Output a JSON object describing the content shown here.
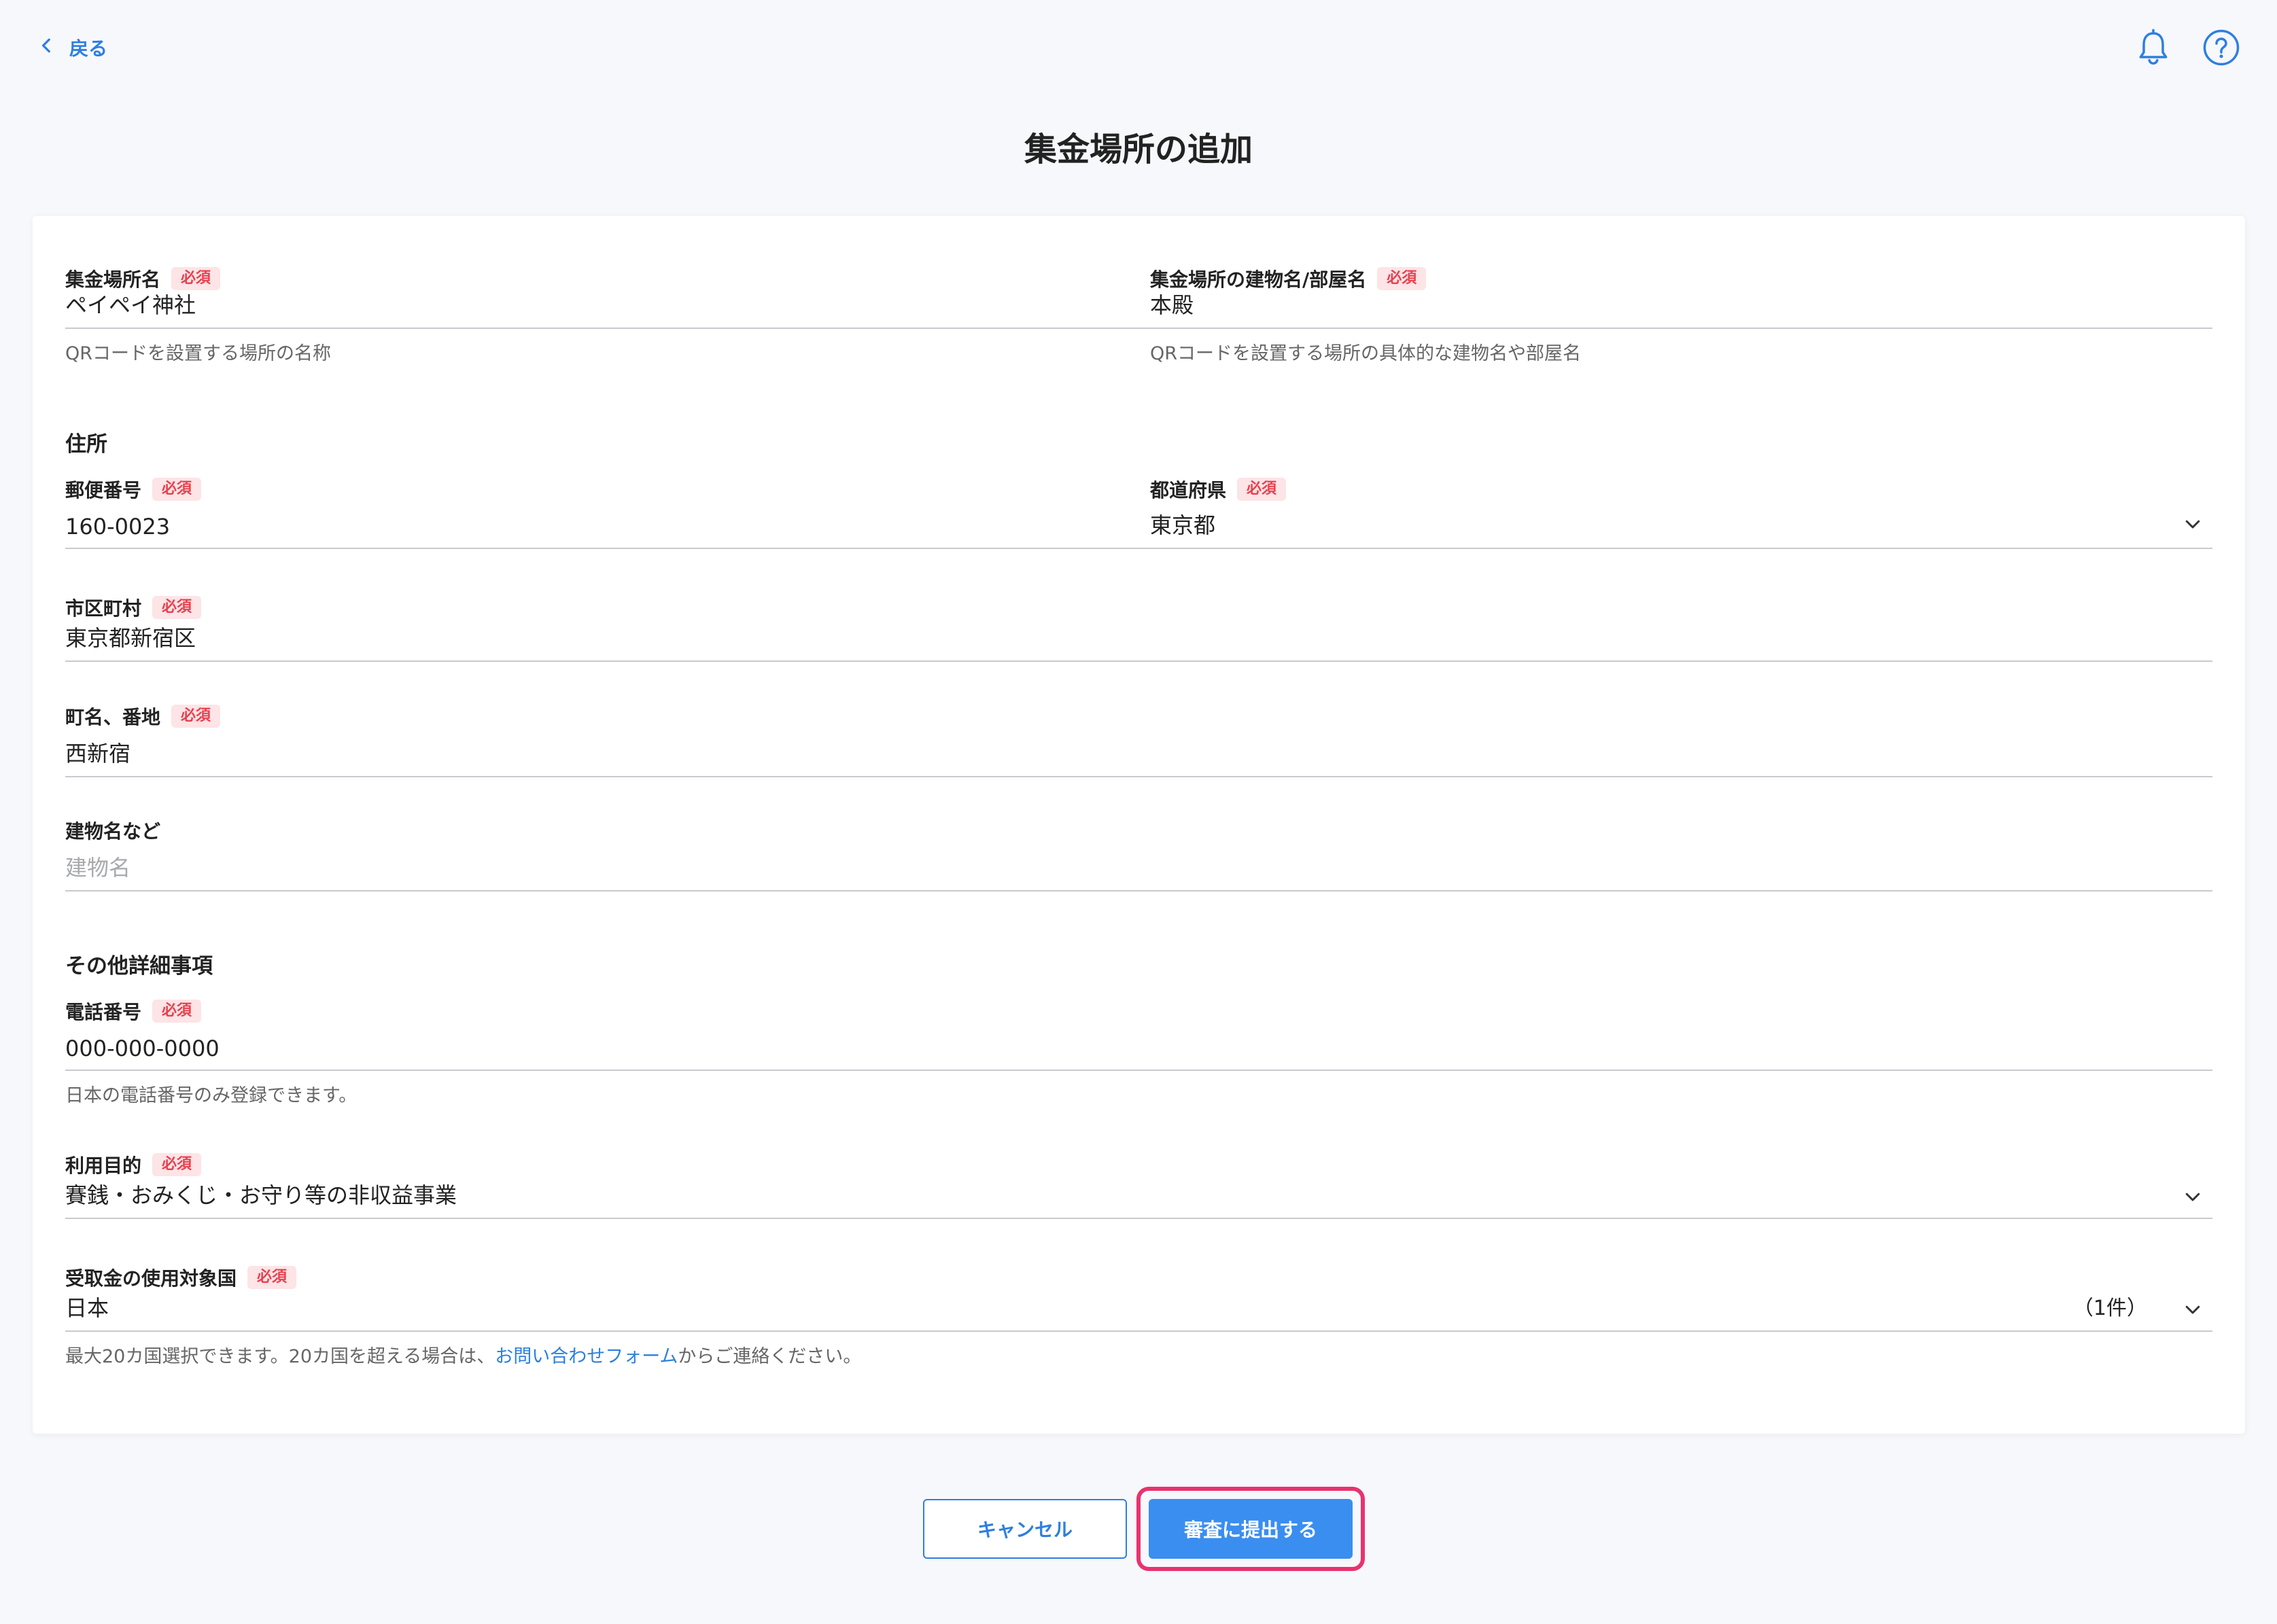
{
  "header": {
    "back_label": "戻る",
    "title": "集金場所の追加",
    "icons": [
      "bell-icon",
      "help-icon"
    ]
  },
  "required_badge": "必須",
  "form": {
    "place_name": {
      "label": "集金場所名",
      "value": "ペイペイ神社",
      "hint": "QRコードを設置する場所の名称"
    },
    "building_room": {
      "label": "集金場所の建物名/部屋名",
      "value": "本殿",
      "hint": "QRコードを設置する場所の具体的な建物名や部屋名"
    },
    "address_section": "住所",
    "postal_code": {
      "label": "郵便番号",
      "value": "160-0023"
    },
    "prefecture": {
      "label": "都道府県",
      "value": "東京都"
    },
    "city": {
      "label": "市区町村",
      "value": "東京都新宿区"
    },
    "town": {
      "label": "町名、番地",
      "value": "西新宿"
    },
    "building": {
      "label": "建物名など",
      "placeholder": "建物名"
    },
    "other_section": "その他詳細事項",
    "phone": {
      "label": "電話番号",
      "value": "000-000-0000",
      "hint": "日本の電話番号のみ登録できます。"
    },
    "purpose": {
      "label": "利用目的",
      "value": "賽銭・おみくじ・お守り等の非収益事業"
    },
    "countries": {
      "label": "受取金の使用対象国",
      "value": "日本",
      "count": "（1件）",
      "hint_before": "最大20カ国選択できます。20カ国を超える場合は、",
      "hint_link": "お問い合わせフォーム",
      "hint_after": "からご連絡ください。"
    }
  },
  "buttons": {
    "cancel": "キャンセル",
    "submit": "審査に提出する"
  },
  "colors": {
    "accent": "#2d7fe0",
    "required_bg": "#fde4e6",
    "required_text": "#e6414f",
    "highlight": "#e8336e"
  }
}
